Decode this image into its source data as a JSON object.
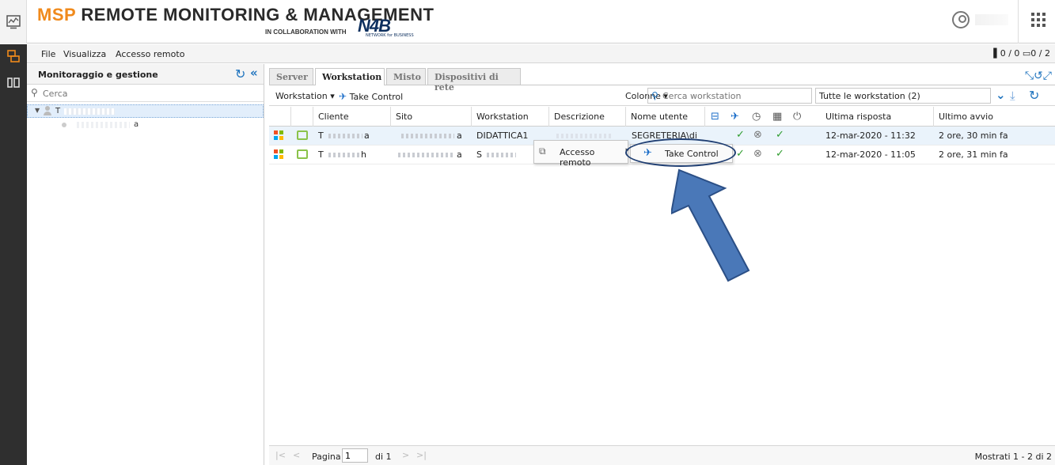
{
  "header": {
    "brand_accent": "MSP",
    "brand_rest": " REMOTE MONITORING & MANAGEMENT",
    "collab": "IN COLLABORATION WITH",
    "partner_logo": "N4B",
    "partner_sub": "NETWORK for BUSINESS",
    "brand_color": "#f08a1c"
  },
  "menubar": {
    "items": [
      "File",
      "Visualizza",
      "Accesso remoto"
    ],
    "counters": "▌0 / 0  ▭0 / 2"
  },
  "leftpanel": {
    "title": "Monitoraggio e gestione",
    "search_placeholder": "Cerca",
    "tree": [
      {
        "label": "T"
      },
      {
        "label": "a"
      }
    ]
  },
  "tabs": [
    {
      "label": "Server",
      "active": false
    },
    {
      "label": "Workstation",
      "active": true
    },
    {
      "label": "Misto",
      "active": false
    },
    {
      "label": "Dispositivi di rete",
      "active": false
    }
  ],
  "toolbar": {
    "workstation_menu": "Workstation ▾",
    "take_control": "Take Control",
    "columns": "Colonne ▾",
    "search_placeholder": "Cerca workstation",
    "filter": "Tutte le workstation (2)"
  },
  "grid": {
    "headers": {
      "cliente": "Cliente",
      "sito": "Sito",
      "workstation": "Workstation",
      "descrizione": "Descrizione",
      "nome_utente": "Nome utente",
      "ultima_risposta": "Ultima risposta",
      "ultimo_avvio": "Ultimo avvio"
    },
    "rows": [
      {
        "cliente": "T",
        "cliente_end": "a",
        "sito_end": "a",
        "workstation": "DIDATTICA1",
        "nome_utente": "SEGRETERIA\\di",
        "ultima_risposta": "12-mar-2020 - 11:32",
        "ultimo_avvio": "2 ore, 30 min fa"
      },
      {
        "cliente": "T",
        "cliente_end": "h",
        "sito_end": "a",
        "workstation": "S",
        "nome_utente": "",
        "ultima_risposta": "12-mar-2020 - 11:05",
        "ultimo_avvio": "2 ore, 31 min fa"
      }
    ]
  },
  "context_menu": {
    "item": "Accesso remoto",
    "submenu_item": "Take Control"
  },
  "pager": {
    "page_label": "Pagina",
    "page_value": "1",
    "of_label": "di 1",
    "shown": "Mostrati 1 - 2 di 2"
  }
}
